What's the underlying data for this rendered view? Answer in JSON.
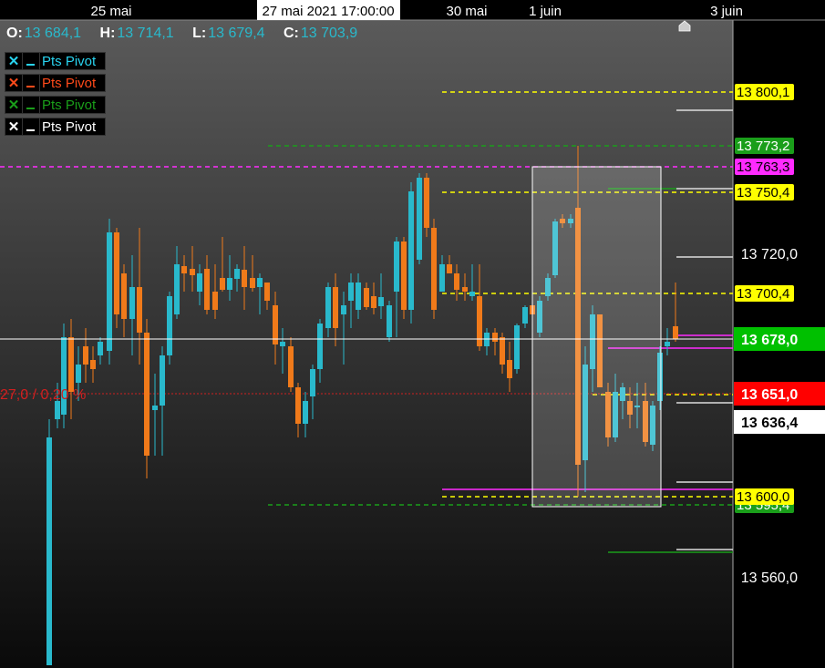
{
  "time_axis": {
    "labels": [
      {
        "text": "25 mai",
        "center": 122
      },
      {
        "text": "30 mai",
        "center": 512
      },
      {
        "text": "1 juin",
        "center": 598
      },
      {
        "text": "3 juin",
        "center": 797
      }
    ],
    "cursor_label": "27 mai 2021 17:00:00"
  },
  "ohlc": {
    "o_key": "O:",
    "o": "13 684,1",
    "h_key": "H:",
    "h": "13 714,1",
    "l_key": "L:",
    "l": "13 679,4",
    "c_key": "C:",
    "c": "13 703,9"
  },
  "legend": [
    {
      "label": "Pts Pivot",
      "color": "#29d4f0",
      "icon": "close-icon"
    },
    {
      "label": "Pts Pivot",
      "color": "#ff4a1a",
      "icon": "close-icon"
    },
    {
      "label": "Pts Pivot",
      "color": "#1a9e1a",
      "icon": "close-icon"
    },
    {
      "label": "Pts Pivot",
      "color": "#ffffff",
      "icon": "close-icon"
    }
  ],
  "price_scale": {
    "ticks": [
      13720,
      13560
    ],
    "tick_labels": [
      "13 720,0",
      "13 560,0"
    ]
  },
  "price_tags": [
    {
      "price": 13800.1,
      "text": "13 800,1",
      "bg": "#ffff00",
      "fg": "#000"
    },
    {
      "price": 13773.2,
      "text": "13 773,2",
      "bg": "#1a9e1a",
      "fg": "#fff"
    },
    {
      "price": 13763.3,
      "text": "13 763,3",
      "bg": "#ff2aff",
      "fg": "#000"
    },
    {
      "price": 13750.4,
      "text": "13 750,4",
      "bg": "#ffff00",
      "fg": "#000"
    },
    {
      "price": 13700.4,
      "text": "13 700,4",
      "bg": "#ffff00",
      "fg": "#000"
    },
    {
      "price": 13678.0,
      "text": "13 678,0",
      "bg": "#00c000",
      "fg": "#fff",
      "big": true
    },
    {
      "price": 13651.0,
      "text": "13 651,0",
      "bg": "#ff0000",
      "fg": "#fff",
      "big": true
    },
    {
      "price": 13636.4,
      "text": "13 636,4",
      "bg": "#ffffff",
      "fg": "#000",
      "big": true
    },
    {
      "price": 13595.4,
      "text": "13 595,4",
      "bg": "#1a9e1a",
      "fg": "#fff"
    },
    {
      "price": 13600.0,
      "text": "13 600,0",
      "bg": "#ffff00",
      "fg": "#000"
    }
  ],
  "range_label": "27,0 / 0,20 %",
  "colors": {
    "up": "#29b9cc",
    "down": "#f07a1a",
    "pivot_yellow": "#ffff00",
    "pivot_green": "#1a9e1a",
    "pivot_magenta": "#ff2aff",
    "crosshair": "#ffffff"
  },
  "chart_data": {
    "type": "candlestick",
    "price_range": [
      13530,
      13830
    ],
    "series": [
      {
        "name": "Pts Pivot",
        "values": [
          13800.1,
          13750.4,
          13700.4,
          13600.0
        ]
      },
      {
        "name": "Pts Pivot",
        "values": [
          13773.2,
          13595.4
        ]
      },
      {
        "name": "Pts Pivot",
        "values": [
          13763.3
        ]
      }
    ]
  }
}
